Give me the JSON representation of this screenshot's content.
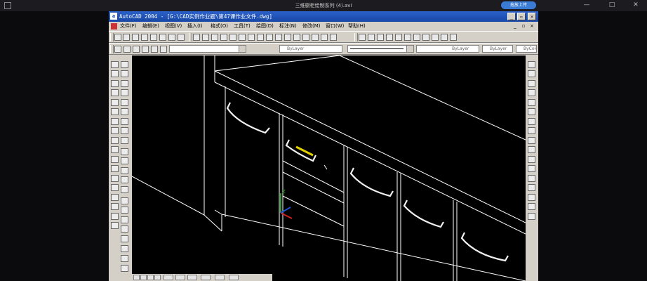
{
  "player": {
    "title": "三维橱柜绘制系列 (4).avi",
    "upload_label": "拖放上传"
  },
  "window": {
    "title": "AutoCAD 2004 - [G:\\CAD实例作业题\\第47课作业文件.dwg]"
  },
  "menu": {
    "items": [
      "文件(F)",
      "编辑(E)",
      "视图(V)",
      "插入(I)",
      "格式(O)",
      "工具(T)",
      "绘图(D)",
      "标注(N)",
      "修改(M)",
      "窗口(W)",
      "帮助(H)"
    ]
  },
  "properties": {
    "layer": "ByLayer",
    "linetype": "ByLayer",
    "lineweight": "ByLayer",
    "color": "ByColor"
  },
  "ucs": {
    "z": "Z"
  },
  "colors": {
    "titlebar": "#1747a6",
    "chrome": "#d4d0c8",
    "canvas": "#000000",
    "highlight_handle": "#e3d000"
  },
  "icons": {
    "left_toolbar": [
      "line-icon",
      "construction-line-icon",
      "polyline-icon",
      "polygon-icon",
      "rectangle-icon",
      "arc-icon",
      "circle-icon",
      "revision-cloud-icon",
      "spline-icon",
      "ellipse-icon",
      "ellipse-arc-icon",
      "insert-block-icon",
      "make-block-icon",
      "point-icon",
      "hatch-icon",
      "region-icon",
      "table-icon",
      "text-icon"
    ],
    "modify_toolbar": [
      "erase-icon",
      "copy-icon",
      "mirror-icon",
      "offset-icon",
      "array-icon",
      "move-icon",
      "rotate-icon",
      "scale-icon",
      "stretch-icon",
      "trim-icon",
      "extend-icon",
      "break-icon",
      "chamfer-icon",
      "fillet-icon",
      "explode-icon"
    ]
  }
}
